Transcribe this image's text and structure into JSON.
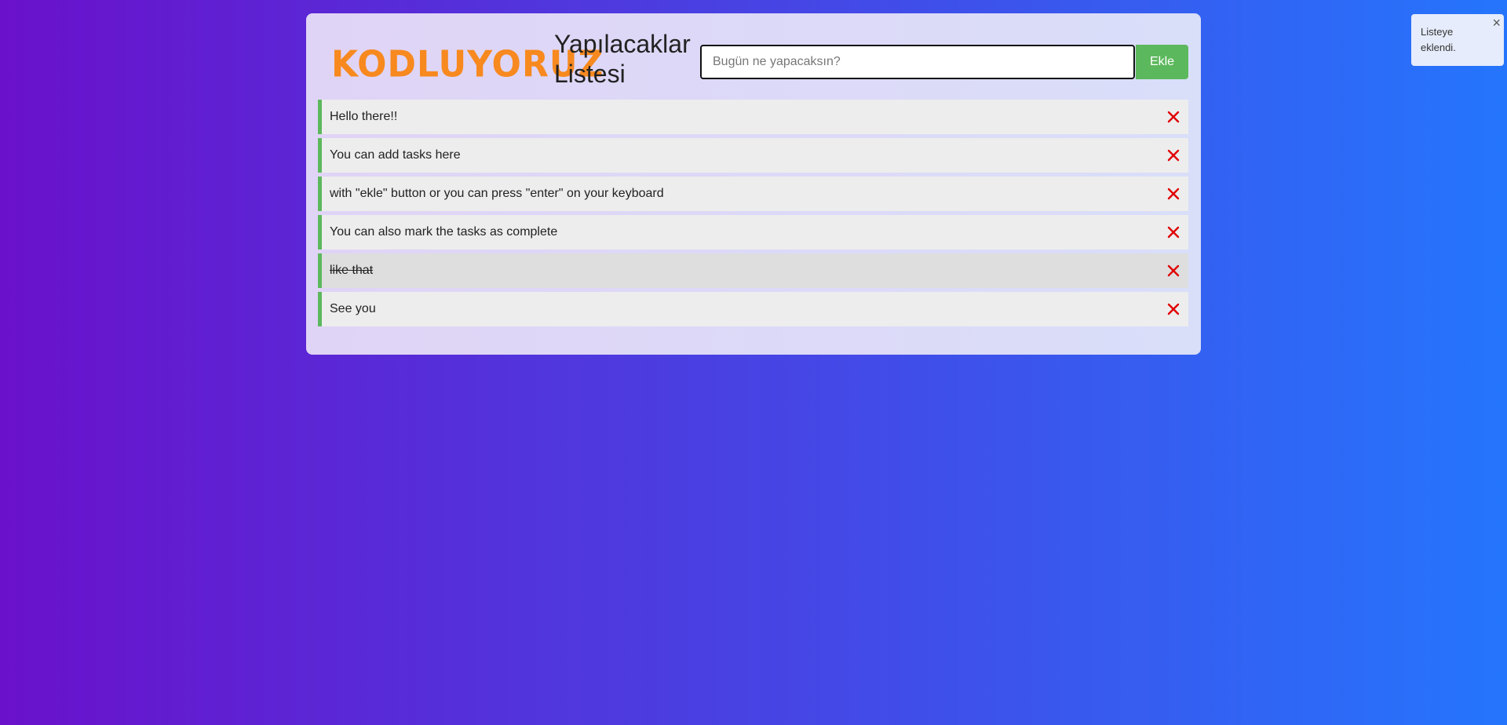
{
  "header": {
    "logo_text": "KODLUYORUZ",
    "title": "Yapılacaklar Listesi"
  },
  "input": {
    "value": "",
    "placeholder": "Bugün ne yapacaksın?"
  },
  "add_button_label": "Ekle",
  "tasks": [
    {
      "label": "Hello there!!",
      "done": false
    },
    {
      "label": "You can add tasks here",
      "done": false
    },
    {
      "label": "with \"ekle\" button or you can press \"enter\" on your keyboard",
      "done": false
    },
    {
      "label": "You can also mark the tasks as complete",
      "done": false
    },
    {
      "label": "like that",
      "done": true
    },
    {
      "label": "See you",
      "done": false
    }
  ],
  "toast": {
    "message": "Listeye eklendi.",
    "close_glyph": "×"
  },
  "colors": {
    "accent": "#5cb85c",
    "logo": "#f7891f",
    "delete": "#e00000",
    "gradient_start": "#6a11cb",
    "gradient_end": "#2575fc"
  },
  "icons": {
    "delete": "close-icon"
  }
}
